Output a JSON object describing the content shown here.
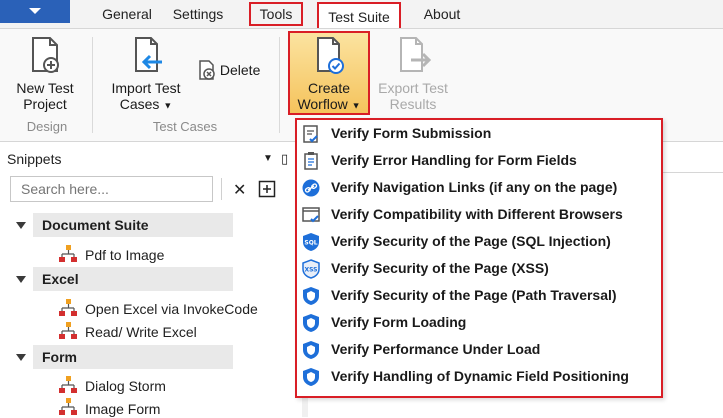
{
  "tabs": [
    "General",
    "Settings",
    "Tools",
    "Test Suite",
    "About"
  ],
  "ribbon": {
    "new_project": [
      "New Test",
      "Project"
    ],
    "import_cases": [
      "Import Test",
      "Cases"
    ],
    "delete": "Delete",
    "create_workflow": [
      "Create",
      "Worflow"
    ],
    "export_results": [
      "Export Test",
      "Results"
    ],
    "groups": {
      "design": "Design",
      "test_cases": "Test Cases"
    }
  },
  "snippets": {
    "title": "Snippets",
    "search_placeholder": "Search here...",
    "groups": [
      {
        "name": "Document Suite",
        "items": [
          "Pdf to Image"
        ]
      },
      {
        "name": "Excel",
        "items": [
          "Open Excel via InvokeCode",
          "Read/ Write Excel"
        ]
      },
      {
        "name": "Form",
        "items": [
          "Dialog Storm",
          "Image Form"
        ]
      }
    ]
  },
  "menu": {
    "items": [
      {
        "label": "Verify Form Submission",
        "icon": "clipboard-check-icon"
      },
      {
        "label": "Verify Error Handling for Form Fields",
        "icon": "clipboard-list-icon"
      },
      {
        "label": "Verify Navigation Links (if any on the page)",
        "icon": "link-icon"
      },
      {
        "label": "Verify Compatibility with Different Browsers",
        "icon": "browser-check-icon"
      },
      {
        "label": "Verify Security of the Page (SQL Injection)",
        "icon": "sql-shield-icon"
      },
      {
        "label": "Verify Security of the Page (XSS)",
        "icon": "xss-shield-icon"
      },
      {
        "label": "Verify Security of the Page (Path Traversal)",
        "icon": "shield-icon"
      },
      {
        "label": "Verify Form Loading",
        "icon": "shield-icon"
      },
      {
        "label": "Verify Performance Under Load",
        "icon": "shield-icon"
      },
      {
        "label": "Verify Handling of Dynamic Field Positioning",
        "icon": "shield-icon"
      }
    ]
  },
  "colors": {
    "accent": "#2a61b8",
    "highlight": "#d91e26",
    "create_bg": "#f5c35c"
  }
}
